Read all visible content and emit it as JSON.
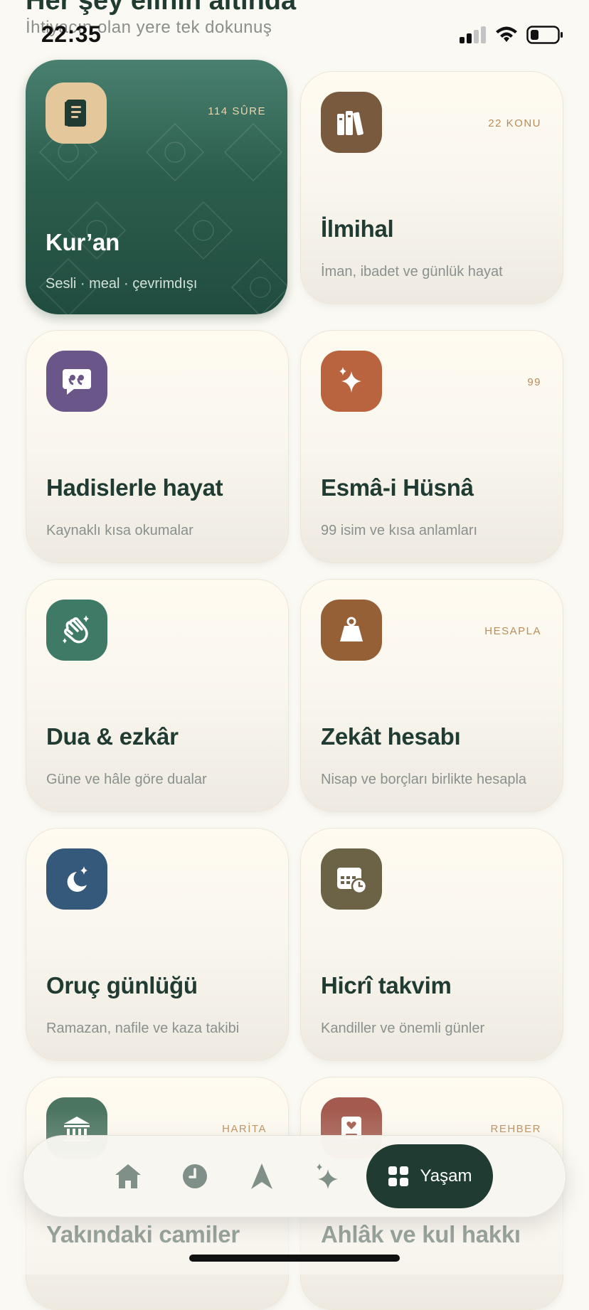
{
  "status_bar": {
    "time": "22:35"
  },
  "header": {
    "title": "Her şey elinin altında",
    "subtitle": "İhtiyacın olan yere tek dokunuş"
  },
  "cards": [
    {
      "title": "Kur’an",
      "subtitle": "Sesli · meal · çevrimdışı",
      "badge": "114 SÛRE",
      "icon": "quran-book-icon",
      "icon_bg": "#e4c79a",
      "featured": true
    },
    {
      "title": "İlmihal",
      "subtitle": "İman, ibadet ve günlük hayat",
      "badge": "22 KONU",
      "icon": "books-icon",
      "icon_bg": "#7a5a3e"
    },
    {
      "title": "Hadislerle hayat",
      "subtitle": "Kaynaklı kısa okumalar",
      "badge": "",
      "icon": "quote-bubble-icon",
      "icon_bg": "#6b5689"
    },
    {
      "title": "Esmâ-i Hüsnâ",
      "subtitle": "99 isim ve kısa anlamları",
      "badge": "99",
      "icon": "sparkle-icon",
      "icon_bg": "#b9643f"
    },
    {
      "title": "Dua & ezkâr",
      "subtitle": "Güne ve hâle göre dualar",
      "badge": "",
      "icon": "praying-hands-icon",
      "icon_bg": "#3e7a66"
    },
    {
      "title": "Zekât hesabı",
      "subtitle": "Nisap ve borçları birlikte hesapla",
      "badge": "HESAPLA",
      "icon": "weight-icon",
      "icon_bg": "#966037"
    },
    {
      "title": "Oruç günlüğü",
      "subtitle": "Ramazan, nafile ve kaza takibi",
      "badge": "",
      "icon": "moon-star-icon",
      "icon_bg": "#34597a"
    },
    {
      "title": "Hicrî takvim",
      "subtitle": "Kandiller ve önemli günler",
      "badge": "",
      "icon": "calendar-clock-icon",
      "icon_bg": "#6c6346"
    },
    {
      "title": "Yakındaki camiler",
      "subtitle": "",
      "badge": "HARİTA",
      "icon": "mosque-icon",
      "icon_bg": "#4b7560"
    },
    {
      "title": "Ahlâk ve kul hakkı",
      "subtitle": "",
      "badge": "REHBER",
      "icon": "heart-book-icon",
      "icon_bg": "#a45a4e"
    }
  ],
  "tab_bar": {
    "tabs": [
      {
        "icon": "home-icon"
      },
      {
        "icon": "clock-icon"
      },
      {
        "icon": "compass-arrow-icon"
      },
      {
        "icon": "sparkle-icon"
      }
    ],
    "active_label": "Yaşam",
    "active_icon": "grid-icon"
  },
  "colors": {
    "primary": "#1f3b32",
    "accent": "#b98c5a",
    "background": "#fbf9f3"
  }
}
